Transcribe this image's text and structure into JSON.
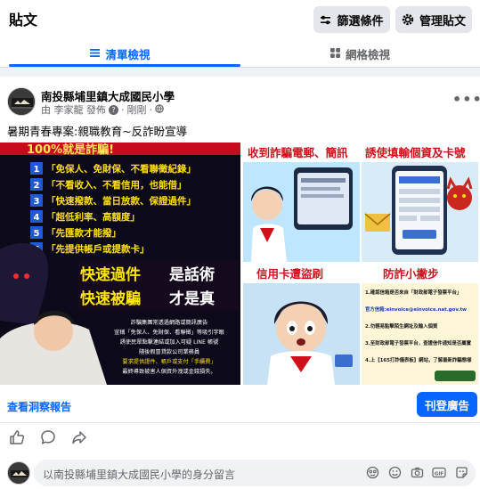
{
  "header": {
    "title": "貼文",
    "filter_label": "篩選條件",
    "manage_label": "管理貼文"
  },
  "tabs": [
    {
      "label": "清單檢視",
      "active": true
    },
    {
      "label": "網格檢視",
      "active": false
    }
  ],
  "post": {
    "author": "南投縣埔里鎮大成國民小學",
    "meta_by": "由 李家龍 發佈",
    "meta_time": "剛剛",
    "text": "暑期青春專案:親職教育~反詐盼宣導",
    "image": {
      "left_panel": {
        "headline": "100%就是詐騙!",
        "list": [
          {
            "n": "1",
            "text": "「免保人、免財保、不看聯徵紀錄」"
          },
          {
            "n": "2",
            "text": "「不看收入、不看信用，也能借」"
          },
          {
            "n": "3",
            "text": "「快速撥款、當日放款、保證過件」"
          },
          {
            "n": "4",
            "text": "「超低利率、高額度」"
          },
          {
            "n": "5",
            "text": "「先匯款才能撥」"
          },
          {
            "n": "6",
            "text": "「先提供帳戶或提款卡」"
          }
        ],
        "slogan_line1_a": "快速過件",
        "slogan_line1_b": "是話術",
        "slogan_line2_a": "快速被騙",
        "slogan_line2_b": "才是真",
        "footer_lines": [
          "詐騙集團常透過網路或簡訊廣告",
          "宣稱「免保人、免財保、看聯徵」等吸引字眼",
          "誘使民眾點擊連結或加入可疑 LINE 帳號",
          "隨後假冒貸款公司業務員",
          "要求提供證件、帳戶或支付「手續費」",
          "最終導致被害人個資外洩或金錢損失。"
        ]
      },
      "right_panels": {
        "p1_title": "收到詐騙電郵、簡訊",
        "p2_title": "誘使填輸個資及卡號",
        "p3_title": "信用卡遭盜刷",
        "p4_title": "防詐小撇步",
        "p4_lines": [
          "1.確認信箱是否來自「財政部電子發票平台」",
          "官方信箱:einvoice@einvoice.nat.gov.tw",
          "2.勿輕易點擊陌生網址及輸入個資",
          "3.至財政部電子發票平台，查證信件通知是否屬實",
          "4.上【165打詐儀表板】網站，了解最新詐騙態樣"
        ]
      }
    },
    "insights_link": "查看洞察報告",
    "boost_label": "刊登廣告"
  },
  "comment": {
    "placeholder": "以南投縣埔里鎮大成國民小學的身分留言"
  },
  "colors": {
    "accent": "#0866ff",
    "muted": "#65676b",
    "panel_bg": "#e4e6eb"
  },
  "icons": [
    "sliders-icon",
    "gear-icon",
    "list-icon",
    "grid-icon",
    "more-icon",
    "like-icon",
    "comment-icon",
    "share-icon",
    "emoji-icon",
    "camera-icon",
    "gif-icon",
    "sticker-icon"
  ]
}
